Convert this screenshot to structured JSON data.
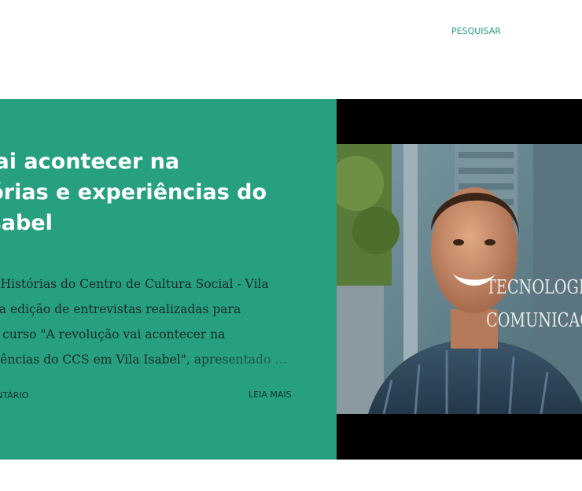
{
  "header": {
    "search_label": "PESQUISAR"
  },
  "post": {
    "title_lines": [
      "o vai acontecer na",
      "istórias e experiências do",
      "a Isabel"
    ],
    "snippet_lines": [
      "deo \"Histórias do Centro de Cultura Social - Vila",
      "é uma edição de entrevistas realizadas para",
      "al de curso \"A revolução vai acontecer na",
      "xperiências do CCS em Vila Isabel\", apresentado …"
    ],
    "comments_label": "OMENTÁRIO",
    "read_more_label": "LEIA MAIS"
  },
  "image": {
    "overlay_line1": "TECNOLOGIAS S",
    "overlay_line2": "COMUNICAÇÃO"
  },
  "colors": {
    "accent": "#26a080",
    "link": "#249b7d",
    "image_bg": "#000000"
  }
}
